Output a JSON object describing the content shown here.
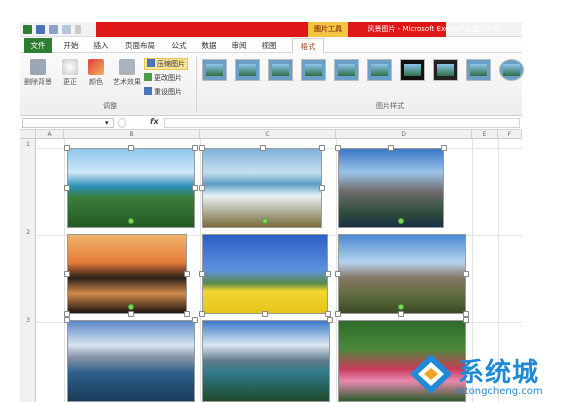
{
  "window": {
    "title": "风景图片 - Microsoft Excel(产品激活失败)",
    "context_tab_group": "图片工具"
  },
  "tabs": [
    "文件",
    "开始",
    "插入",
    "页面布局",
    "公式",
    "数据",
    "审阅",
    "视图",
    "格式"
  ],
  "active_tab": "格式",
  "ribbon": {
    "adjust": {
      "remove_bg": "删除背景",
      "corrections": "更正",
      "color": "颜色",
      "art_effects": "艺术效果",
      "compress": "压缩图片",
      "change": "更改图片",
      "reset": "重设图片",
      "group_label": "调整"
    },
    "styles": {
      "group_label": "图片样式"
    }
  },
  "formula": {
    "fx": "fx",
    "value": ""
  },
  "columns": [
    "A",
    "B",
    "C",
    "D",
    "E",
    "F"
  ],
  "rows": [
    "1",
    "2",
    "3"
  ],
  "watermark": {
    "brand_cn": "系统城",
    "site": "xitongcheng.com"
  },
  "colors": {
    "title_red": "#e01717",
    "file_tab": "#2e7d32",
    "context_tab": "#f4c542"
  }
}
